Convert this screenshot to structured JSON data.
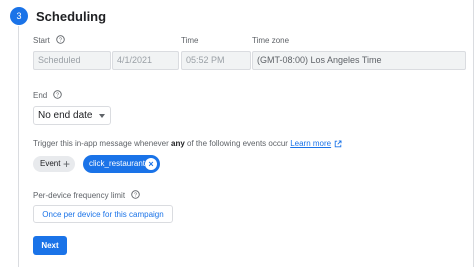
{
  "step": {
    "number": "3",
    "title": "Scheduling"
  },
  "start": {
    "label": "Start",
    "status_value": "Scheduled",
    "date_value": "4/1/2021"
  },
  "time": {
    "label": "Time",
    "value": "05:52 PM"
  },
  "timezone": {
    "label": "Time zone",
    "value": "(GMT-08:00) Los Angeles Time"
  },
  "end": {
    "label": "End",
    "selected": "No end date"
  },
  "trigger": {
    "text_before": "Trigger this in-app message whenever ",
    "emphasis": "any",
    "text_after": " of the following events occur ",
    "link": "Learn more"
  },
  "events": {
    "add_chip_label": "Event",
    "selected": [
      "click_restaurant"
    ]
  },
  "frequency": {
    "label": "Per-device frequency limit",
    "button_label": "Once per device for this campaign"
  },
  "actions": {
    "next_label": "Next"
  },
  "colors": {
    "accent": "#1a73e8",
    "disabled_bg": "#f1f3f4",
    "chip_bg": "#e8eaed"
  },
  "icons": {
    "help": "help-circle-icon",
    "external_link": "external-link-icon",
    "dropdown": "caret-down-icon",
    "add": "plus-icon",
    "remove": "close-circle-icon"
  }
}
